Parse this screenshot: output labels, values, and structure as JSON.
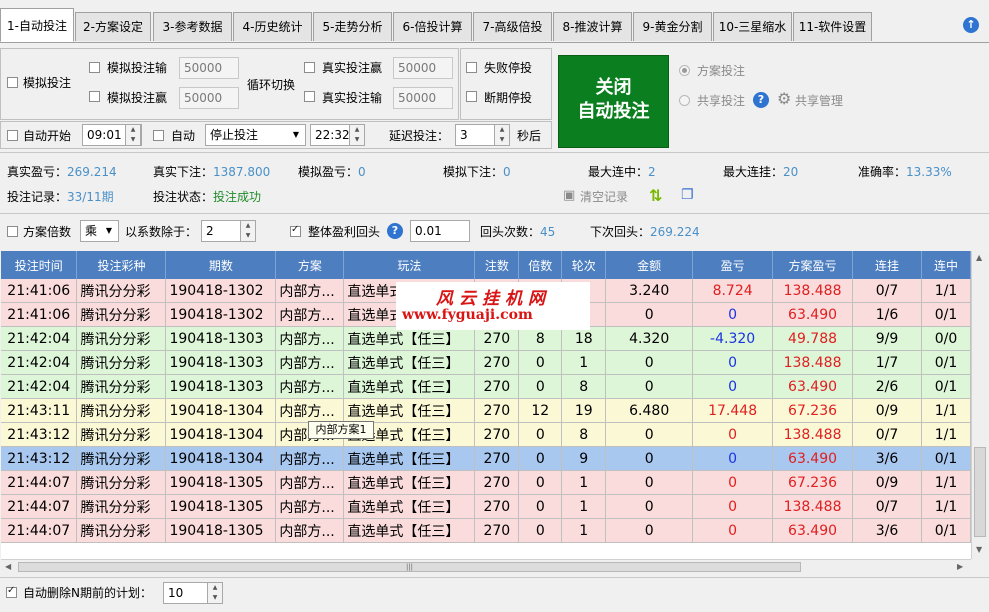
{
  "tabs": [
    {
      "label": "1-自动投注",
      "active": true
    },
    {
      "label": "2-方案设定"
    },
    {
      "label": "3-参考数据"
    },
    {
      "label": "4-历史统计"
    },
    {
      "label": "5-走势分析"
    },
    {
      "label": "6-倍投计算"
    },
    {
      "label": "7-高级倍投"
    },
    {
      "label": "8-推波计算"
    },
    {
      "label": "9-黄金分割"
    },
    {
      "label": "10-三星缩水"
    },
    {
      "label": "11-软件设置"
    }
  ],
  "sim": {
    "mode_label": "模拟投注",
    "lose_label": "模拟投注输",
    "lose_value": "50000",
    "win_label": "模拟投注赢",
    "win_value": "50000",
    "cycle_label": "循环切换",
    "real_win_label": "真实投注赢",
    "real_win_value": "50000",
    "real_lose_label": "真实投注输",
    "real_lose_value": "50000",
    "fail_stop_label": "失败停投",
    "break_stop_label": "断期停投"
  },
  "big_button": {
    "line1": "关闭",
    "line2": "自动投注"
  },
  "right_opts": {
    "plan_bet": "方案投注",
    "share_bet": "共享投注",
    "share_manage": "共享管理"
  },
  "schedule": {
    "auto_start_label": "自动开始",
    "start_time": "09:01",
    "auto_label": "自动",
    "action_value": "停止投注",
    "end_time": "22:32",
    "delay_label": "延迟投注：",
    "delay_value": "3",
    "seconds_label": "秒后"
  },
  "stats": {
    "real_profit_label": "真实盈亏：",
    "real_profit": "269.214",
    "real_bet_label": "真实下注：",
    "real_bet": "1387.800",
    "sim_profit_label": "模拟盈亏：",
    "sim_profit": "0",
    "sim_bet_label": "模拟下注：",
    "sim_bet": "0",
    "max_streak_label": "最大连中：",
    "max_streak": "2",
    "max_fail_label": "最大连挂：",
    "max_fail": "20",
    "accuracy_label": "准确率：",
    "accuracy": "13.33%",
    "record_label": "投注记录：",
    "record": "33/11期",
    "status_label": "投注状态：",
    "status": "投注成功",
    "clear_label": "清空记录"
  },
  "multi": {
    "plan_mult_label": "方案倍数",
    "op_value": "乘",
    "divide_label": "以系数除于：",
    "divide_value": "2",
    "overall_label": "整体盈利回头",
    "overall_value": "0.01",
    "return_count_label": "回头次数：",
    "return_count": "45",
    "next_return_label": "下次回头：",
    "next_return": "269.224"
  },
  "table": {
    "columns": [
      "投注时间",
      "投注彩种",
      "期数",
      "方案",
      "玩法",
      "注数",
      "倍数",
      "轮次",
      "金额",
      "盈亏",
      "方案盈亏",
      "连挂",
      "连中"
    ],
    "rows": [
      {
        "cls": "pink",
        "cells": [
          "21:41:06",
          "腾讯分分彩",
          "190418-1302",
          "内部方...",
          "直选单式【任三】",
          "270",
          "6",
          "7",
          "3.240",
          "8.724",
          "138.488",
          "0/7",
          "1/1"
        ],
        "pnl": "red"
      },
      {
        "cls": "pink",
        "cells": [
          "21:41:06",
          "腾讯分分彩",
          "190418-1302",
          "内部方...",
          "直选单式【任三】",
          "270",
          "0",
          "1",
          "0",
          "0",
          "63.490",
          "1/6",
          "0/1"
        ],
        "pnl": "blue"
      },
      {
        "cls": "green",
        "cells": [
          "21:42:04",
          "腾讯分分彩",
          "190418-1303",
          "内部方...",
          "直选单式【任三】",
          "270",
          "8",
          "18",
          "4.320",
          "-4.320",
          "49.788",
          "9/9",
          "0/0"
        ],
        "pnl": "blue"
      },
      {
        "cls": "green",
        "cells": [
          "21:42:04",
          "腾讯分分彩",
          "190418-1303",
          "内部方...",
          "直选单式【任三】",
          "270",
          "0",
          "1",
          "0",
          "0",
          "138.488",
          "1/7",
          "0/1"
        ],
        "pnl": "blue"
      },
      {
        "cls": "green",
        "cells": [
          "21:42:04",
          "腾讯分分彩",
          "190418-1303",
          "内部方...",
          "直选单式【任三】",
          "270",
          "0",
          "8",
          "0",
          "0",
          "63.490",
          "2/6",
          "0/1"
        ],
        "pnl": "blue"
      },
      {
        "cls": "yellow",
        "cells": [
          "21:43:11",
          "腾讯分分彩",
          "190418-1304",
          "内部方...",
          "直选单式【任三】",
          "270",
          "12",
          "19",
          "6.480",
          "17.448",
          "67.236",
          "0/9",
          "1/1"
        ],
        "pnl": "red"
      },
      {
        "cls": "yellow",
        "cells": [
          "21:43:12",
          "腾讯分分彩",
          "190418-1304",
          "内部方...",
          "直选单式【任三】",
          "270",
          "0",
          "8",
          "0",
          "0",
          "138.488",
          "0/7",
          "1/1"
        ],
        "pnl": "red"
      },
      {
        "cls": "sel",
        "cells": [
          "21:43:12",
          "腾讯分分彩",
          "190418-1304",
          "内部方...",
          "直选单式【任三】",
          "270",
          "0",
          "9",
          "0",
          "0",
          "63.490",
          "3/6",
          "0/1"
        ],
        "pnl": "blue"
      },
      {
        "cls": "pink",
        "cells": [
          "21:44:07",
          "腾讯分分彩",
          "190418-1305",
          "内部方...",
          "直选单式【任三】",
          "270",
          "0",
          "1",
          "0",
          "0",
          "67.236",
          "0/9",
          "1/1"
        ],
        "pnl": "red"
      },
      {
        "cls": "pink",
        "cells": [
          "21:44:07",
          "腾讯分分彩",
          "190418-1305",
          "内部方...",
          "直选单式【任三】",
          "270",
          "0",
          "1",
          "0",
          "0",
          "138.488",
          "0/7",
          "1/1"
        ],
        "pnl": "red"
      },
      {
        "cls": "pink",
        "cells": [
          "21:44:07",
          "腾讯分分彩",
          "190418-1305",
          "内部方...",
          "直选单式【任三】",
          "270",
          "0",
          "1",
          "0",
          "0",
          "63.490",
          "3/6",
          "0/1"
        ],
        "pnl": "red"
      }
    ]
  },
  "tooltip": "内部方案1",
  "watermark": {
    "line1": "风云挂机网",
    "line2": "www.fyguaji.com"
  },
  "footer": {
    "auto_delete_label": "自动删除N期前的计划：",
    "auto_delete_value": "10"
  },
  "colors": {
    "header": "#4c7ec0",
    "button_green": "#0b7f1f",
    "profit_red": "#e02020",
    "profit_blue": "#1a34e0",
    "selected_row": "#a8c8f0"
  }
}
